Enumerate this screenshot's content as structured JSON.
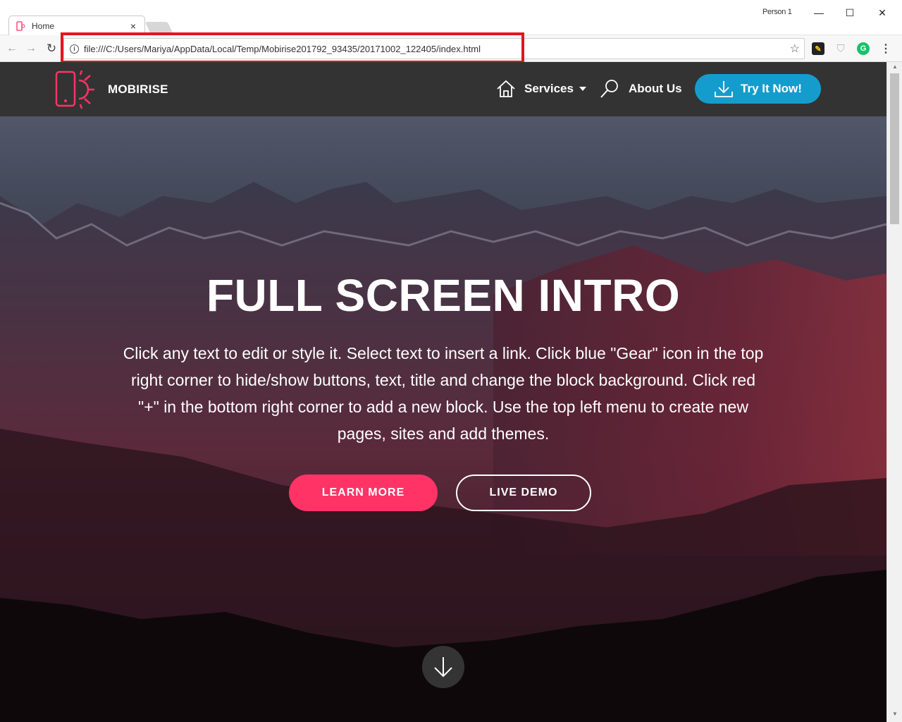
{
  "browser": {
    "tab_title": "Home",
    "tab_close": "×",
    "profile": "Person 1",
    "minimize": "—",
    "maximize": "☐",
    "close": "✕",
    "back": "←",
    "forward": "→",
    "reload": "↻",
    "info": "i",
    "url": "file:///C:/Users/Mariya/AppData/Local/Temp/Mobirise201792_93435/20171002_122405/index.html",
    "bookmark": "☆",
    "menu": "⋮",
    "ext_grammarly": "G",
    "ext_shield": "⛉",
    "ext_generic": "✎",
    "icons": {
      "tab_favicon": "mobirise-favicon-icon",
      "info": "info-icon",
      "bookmark": "star-icon"
    },
    "highlight_color": "#e5141f"
  },
  "site": {
    "brand": "MOBIRISE",
    "nav": {
      "services": "Services",
      "about": "About Us",
      "try": "Try It Now!"
    },
    "hero": {
      "title": "FULL SCREEN INTRO",
      "text": "Click any text to edit or style it. Select text to insert a link. Click blue \"Gear\" icon in the top right corner to hide/show buttons, text, title and change the block background. Click red \"+\" in the bottom right corner to add a new block. Use the top left menu to create new pages, sites and add themes.",
      "learn_more": "LEARN MORE",
      "live_demo": "LIVE DEMO"
    },
    "colors": {
      "navbar": "#333333",
      "accent_blue": "#149dcc",
      "accent_pink": "#ff3366",
      "logo": "#ff3366"
    },
    "icons": {
      "logo": "phone-sun-logo-icon",
      "home": "home-icon",
      "search": "search-icon",
      "download": "download-icon",
      "scroll": "arrow-down-icon"
    }
  }
}
